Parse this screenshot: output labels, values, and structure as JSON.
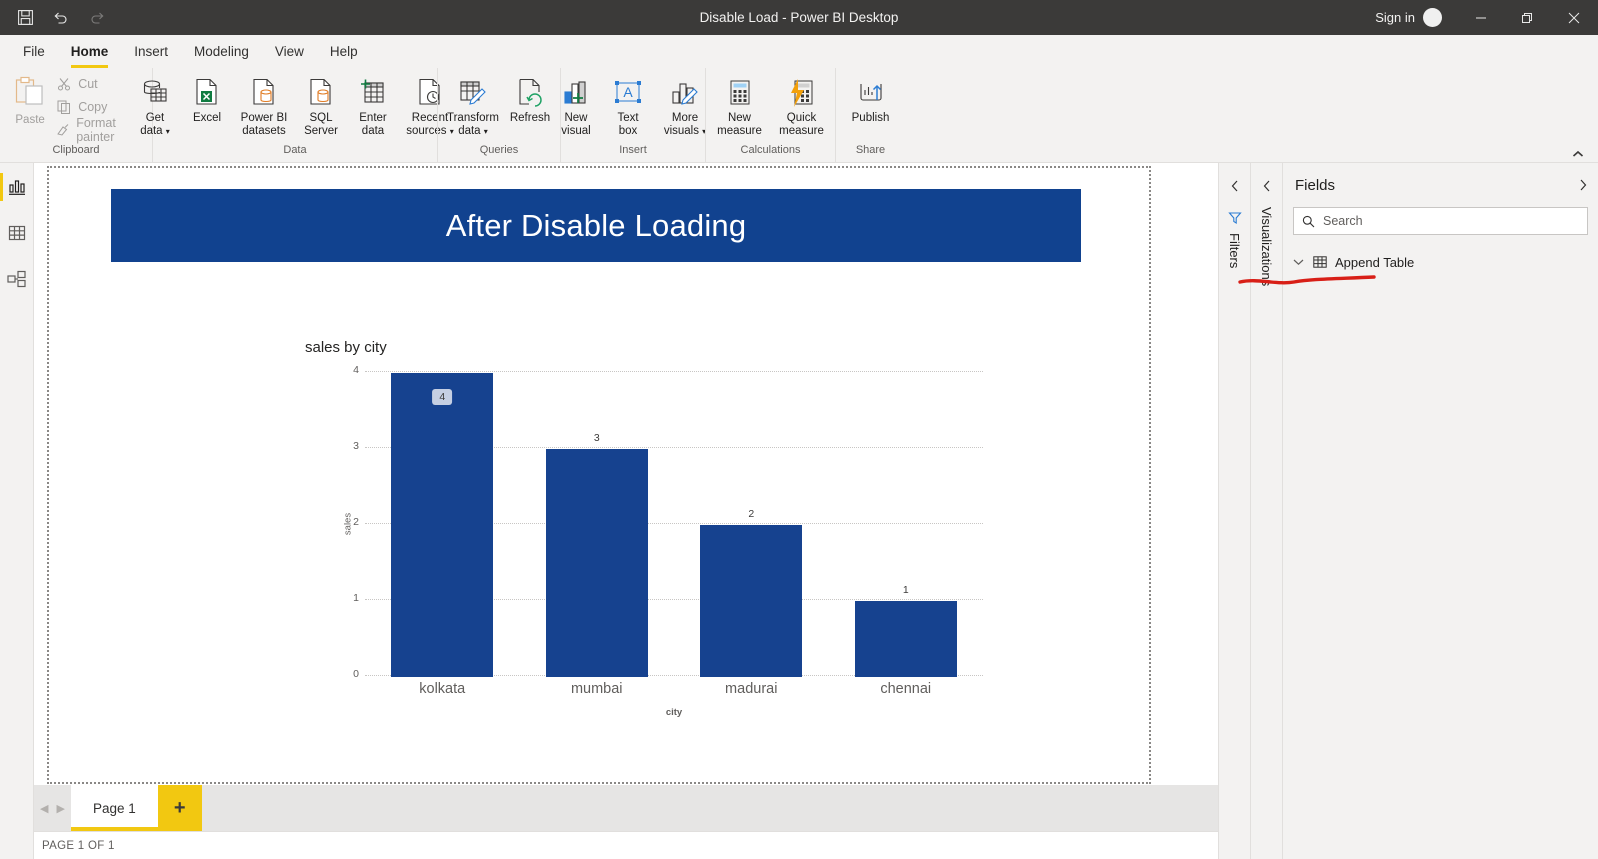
{
  "window": {
    "title": "Disable Load - Power BI Desktop",
    "sign_in": "Sign in",
    "quick_access": [
      "save-icon",
      "undo-icon",
      "redo-icon"
    ],
    "controls": [
      "minimize-icon",
      "restore-icon",
      "close-icon"
    ]
  },
  "menu": {
    "tabs": [
      {
        "label": "File",
        "active": false
      },
      {
        "label": "Home",
        "active": true
      },
      {
        "label": "Insert",
        "active": false
      },
      {
        "label": "Modeling",
        "active": false
      },
      {
        "label": "View",
        "active": false
      },
      {
        "label": "Help",
        "active": false
      }
    ]
  },
  "ribbon": {
    "groups": [
      {
        "name": "Clipboard",
        "label": "Clipboard",
        "paste": "Paste",
        "items": [
          {
            "label": "Cut",
            "icon": "scissors-icon"
          },
          {
            "label": "Copy",
            "icon": "copy-icon"
          },
          {
            "label": "Format painter",
            "icon": "format-painter-icon"
          }
        ]
      },
      {
        "name": "Data",
        "label": "Data",
        "items": [
          {
            "label": "Get\ndata",
            "line1": "Get",
            "line2": "data",
            "caret": true,
            "icon": "get-data-icon"
          },
          {
            "label": "Excel",
            "line1": "Excel",
            "line2": "",
            "caret": false,
            "icon": "excel-icon"
          },
          {
            "label": "Power BI datasets",
            "line1": "Power BI",
            "line2": "datasets",
            "caret": false,
            "icon": "powerbi-datasets-icon"
          },
          {
            "label": "SQL Server",
            "line1": "SQL",
            "line2": "Server",
            "caret": false,
            "icon": "sql-server-icon"
          },
          {
            "label": "Enter data",
            "line1": "Enter",
            "line2": "data",
            "caret": false,
            "icon": "enter-data-icon"
          },
          {
            "label": "Recent sources",
            "line1": "Recent",
            "line2": "sources",
            "caret": true,
            "icon": "recent-sources-icon"
          }
        ]
      },
      {
        "name": "Queries",
        "label": "Queries",
        "items": [
          {
            "label": "Transform data",
            "line1": "Transform",
            "line2": "data",
            "caret": true,
            "icon": "transform-data-icon"
          },
          {
            "label": "Refresh",
            "line1": "Refresh",
            "line2": "",
            "caret": false,
            "icon": "refresh-icon"
          }
        ]
      },
      {
        "name": "Insert",
        "label": "Insert",
        "items": [
          {
            "label": "New visual",
            "line1": "New",
            "line2": "visual",
            "caret": false,
            "icon": "new-visual-icon"
          },
          {
            "label": "Text box",
            "line1": "Text",
            "line2": "box",
            "caret": false,
            "icon": "text-box-icon"
          },
          {
            "label": "More visuals",
            "line1": "More",
            "line2": "visuals",
            "caret": true,
            "icon": "more-visuals-icon"
          }
        ]
      },
      {
        "name": "Calculations",
        "label": "Calculations",
        "items": [
          {
            "label": "New measure",
            "line1": "New",
            "line2": "measure",
            "caret": false,
            "icon": "new-measure-icon"
          },
          {
            "label": "Quick measure",
            "line1": "Quick",
            "line2": "measure",
            "caret": false,
            "icon": "quick-measure-icon"
          }
        ]
      },
      {
        "name": "Share",
        "label": "Share",
        "items": [
          {
            "label": "Publish",
            "line1": "Publish",
            "line2": "",
            "caret": false,
            "icon": "publish-icon"
          }
        ]
      }
    ]
  },
  "left_nav": {
    "items": [
      {
        "name": "report-view",
        "icon": "report-bar-chart-icon",
        "active": true
      },
      {
        "name": "data-view",
        "icon": "data-table-icon",
        "active": false
      },
      {
        "name": "model-view",
        "icon": "model-relationships-icon",
        "active": false
      }
    ]
  },
  "canvas": {
    "banner_text": "After Disable Loading",
    "banner_color": "#11428F"
  },
  "chart_data": {
    "type": "bar",
    "title": "sales by city",
    "categories": [
      "kolkata",
      "mumbai",
      "madurai",
      "chennai"
    ],
    "values": [
      4,
      3,
      2,
      1
    ],
    "labels": [
      "4",
      "3",
      "2",
      "1"
    ],
    "xlabel": "city",
    "ylabel": "sales",
    "ylim": [
      0,
      4
    ],
    "yticks": [
      "4",
      "3",
      "2",
      "1",
      "0"
    ],
    "grid": true,
    "legend": "none",
    "series_color": "#16428F",
    "highlighted_label_index": 0,
    "highlight_bg": "#c5cfe3"
  },
  "panels": {
    "filters_rail": {
      "label": "Filters",
      "chevron": "chevron-left-icon",
      "icon": "filter-funnel-icon"
    },
    "visualizations_rail": {
      "label": "Visualizations",
      "chevron": "chevron-left-icon"
    },
    "fields": {
      "title": "Fields",
      "expand_icon": "chevron-right-icon",
      "search_placeholder": "Search",
      "search_value": "",
      "tables": [
        {
          "name": "Append Table",
          "expanded": true,
          "annotated": true
        }
      ],
      "annotation_color": "#d81f17"
    }
  },
  "footer": {
    "page_tabs": [
      {
        "label": "Page 1",
        "active": true
      }
    ],
    "add_page_label": "+",
    "status": "PAGE 1 OF 1",
    "prev_icon": "chevron-left-icon",
    "next_icon": "chevron-right-icon"
  }
}
